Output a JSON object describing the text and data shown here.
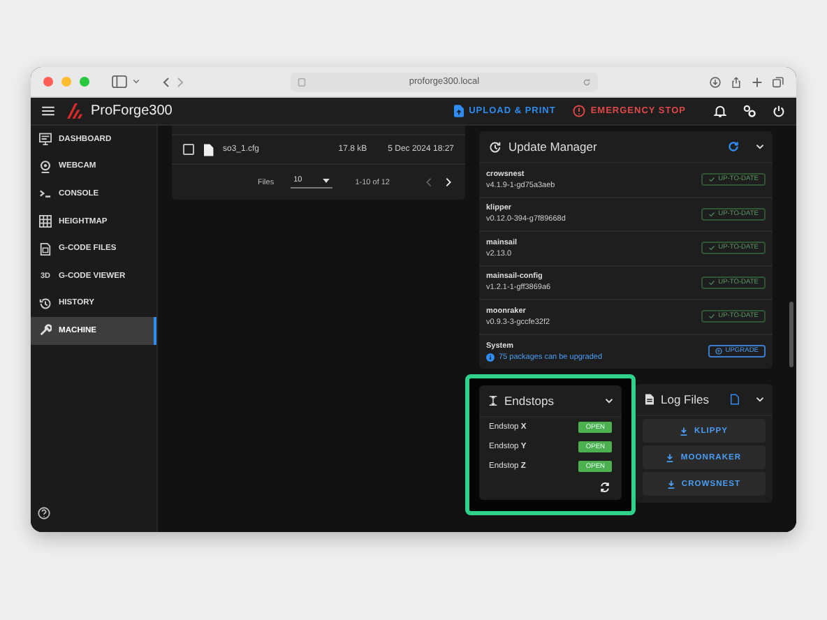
{
  "browser": {
    "url": "proforge300.local"
  },
  "app": {
    "title": "ProForge300"
  },
  "header_actions": [
    {
      "kind": "upload",
      "label": "UPLOAD & PRINT"
    },
    {
      "kind": "stop",
      "label": "EMERGENCY STOP"
    }
  ],
  "sidebar": {
    "items": [
      {
        "kind": "dashboard",
        "label": "DASHBOARD",
        "selected": false
      },
      {
        "kind": "webcam",
        "label": "WEBCAM",
        "selected": false
      },
      {
        "kind": "console",
        "label": "CONSOLE",
        "selected": false
      },
      {
        "kind": "heightmap",
        "label": "HEIGHTMAP",
        "selected": false
      },
      {
        "kind": "files",
        "label": "G-CODE FILES",
        "selected": false
      },
      {
        "kind": "viewer",
        "icon_text": "3D",
        "label": "G-CODE VIEWER",
        "selected": false
      },
      {
        "kind": "history",
        "label": "HISTORY",
        "selected": false
      },
      {
        "kind": "machine",
        "label": "MACHINE",
        "selected": true
      }
    ]
  },
  "files": {
    "rows": [
      {
        "name": "so3_1.cfg",
        "size": "17.8 kB",
        "date": "5 Dec 2024 18:27",
        "checked": false
      }
    ],
    "pagination": {
      "label": "Files",
      "per_page": "10",
      "range": "1-10 of 12"
    }
  },
  "update_manager": {
    "title": "Update Manager",
    "items": [
      {
        "kind": "package",
        "name": "crowsnest",
        "version": "v4.1.9-1-gd75a3aeb",
        "status": "UP-TO-DATE"
      },
      {
        "kind": "package",
        "name": "klipper",
        "version": "v0.12.0-394-g7f89668d",
        "status": "UP-TO-DATE"
      },
      {
        "kind": "package",
        "name": "mainsail",
        "version": "v2.13.0",
        "status": "UP-TO-DATE"
      },
      {
        "kind": "package",
        "name": "mainsail-config",
        "version": "v1.2.1-1-gff3869a6",
        "status": "UP-TO-DATE"
      },
      {
        "kind": "package",
        "name": "moonraker",
        "version": "v0.9.3-3-gccfe32f2",
        "status": "UP-TO-DATE"
      },
      {
        "kind": "system",
        "name": "System",
        "version": "75 packages can be upgraded",
        "status": "UPGRADE"
      }
    ]
  },
  "endstops": {
    "title": "Endstops",
    "highlighted": true,
    "items": [
      {
        "label": "Endstop **X**",
        "state": "OPEN",
        "open": true
      },
      {
        "label": "Endstop **Y**",
        "state": "OPEN",
        "open": true
      },
      {
        "label": "Endstop **Z**",
        "state": "OPEN",
        "open": true
      }
    ]
  },
  "log_files": {
    "title": "Log Files",
    "buttons": [
      "KLIPPY",
      "MOONRAKER",
      "CROWSNEST"
    ]
  }
}
